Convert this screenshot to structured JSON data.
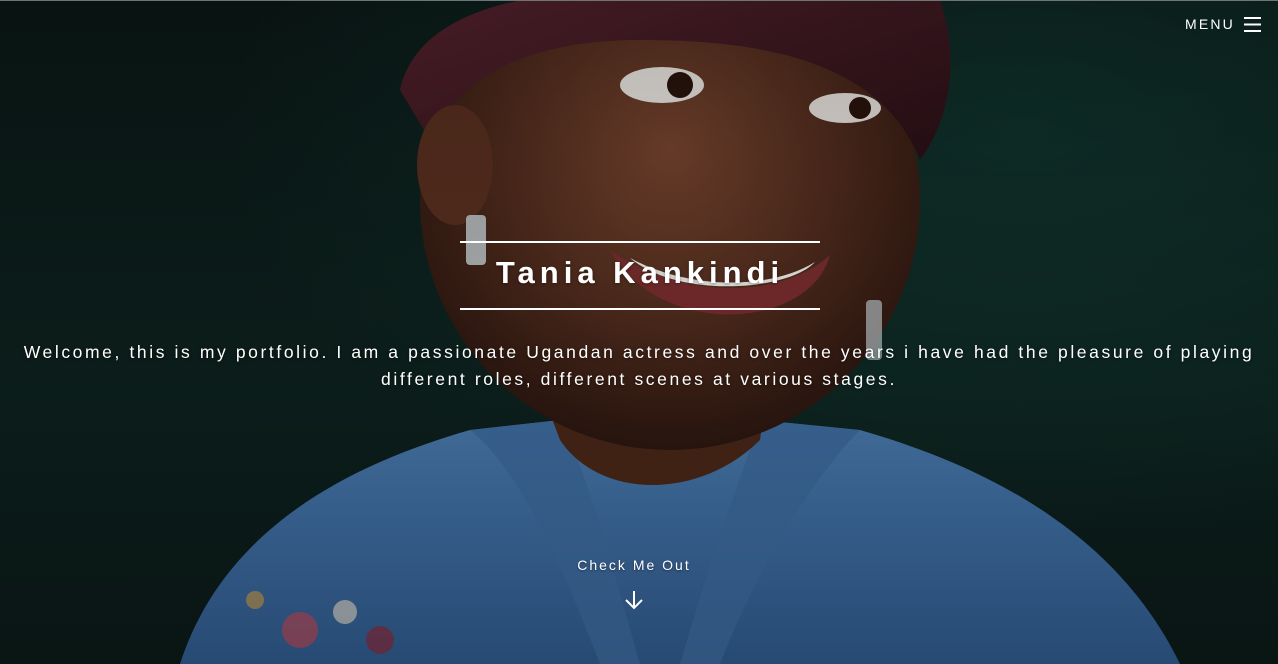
{
  "header": {
    "menu_label": "MENU",
    "menu_icon": "hamburger-icon"
  },
  "hero": {
    "name": "Tania Kankindi",
    "intro": "Welcome, this is my portfolio. I am a passionate Ugandan actress and over the years i have had the pleasure of playing different roles, different scenes at various stages.",
    "cta_label": "Check Me Out",
    "cta_icon": "arrow-down-icon",
    "background_image": "portrait-photo",
    "colors": {
      "text": "#ffffff",
      "background": "#0c1a18",
      "denim": "#3a6aa0"
    }
  }
}
